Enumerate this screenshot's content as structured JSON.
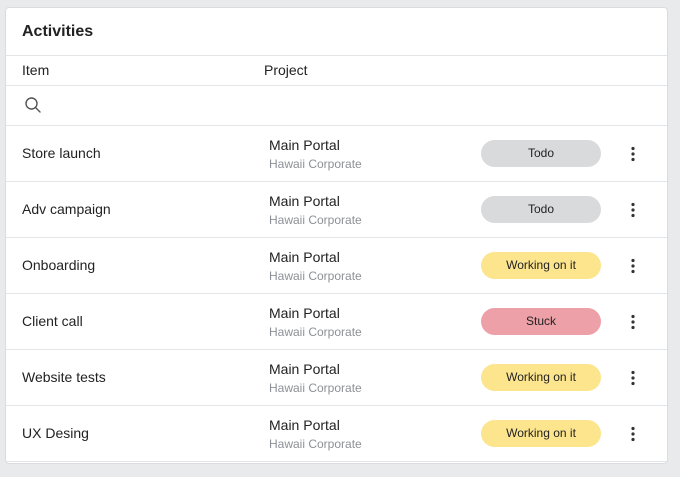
{
  "card": {
    "title": "Activities"
  },
  "table": {
    "headers": {
      "item": "Item",
      "project": "Project"
    },
    "search": {
      "icon": "search-icon",
      "value": "",
      "placeholder": ""
    },
    "rows": [
      {
        "item": "Store launch",
        "project": "Main Portal",
        "client": "Hawaii Corporate",
        "status": "Todo",
        "status_kind": "todo"
      },
      {
        "item": "Adv campaign",
        "project": "Main Portal",
        "client": "Hawaii Corporate",
        "status": "Todo",
        "status_kind": "todo"
      },
      {
        "item": "Onboarding",
        "project": "Main Portal",
        "client": "Hawaii Corporate",
        "status": "Working on it",
        "status_kind": "working"
      },
      {
        "item": "Client call",
        "project": "Main Portal",
        "client": "Hawaii Corporate",
        "status": "Stuck",
        "status_kind": "stuck"
      },
      {
        "item": "Website tests",
        "project": "Main Portal",
        "client": "Hawaii Corporate",
        "status": "Working on it",
        "status_kind": "working"
      },
      {
        "item": "UX Desing",
        "project": "Main Portal",
        "client": "Hawaii Corporate",
        "status": "Working on it",
        "status_kind": "working"
      }
    ],
    "row_menu_icon": "more-vertical-icon"
  },
  "colors": {
    "todo": "#d8dadb",
    "working": "#fde58e",
    "stuck": "#eda0a7",
    "background": "#e9eaec",
    "card": "#ffffff"
  }
}
